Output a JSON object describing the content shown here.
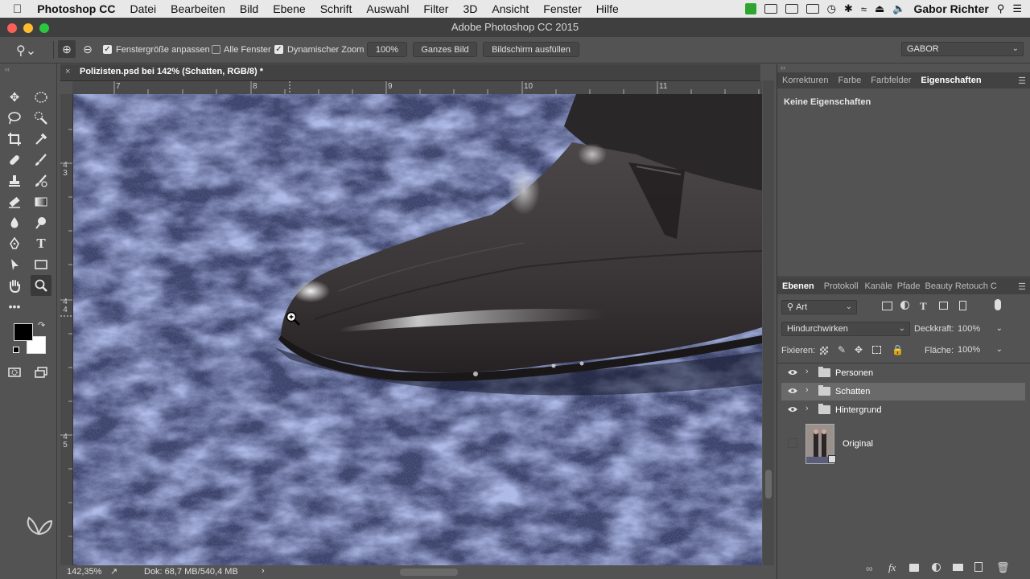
{
  "menubar": {
    "app_name": "Photoshop CC",
    "items": [
      "Datei",
      "Bearbeiten",
      "Bild",
      "Ebene",
      "Schrift",
      "Auswahl",
      "Filter",
      "3D",
      "Ansicht",
      "Fenster",
      "Hilfe"
    ],
    "user": "Gabor Richter"
  },
  "window": {
    "title": "Adobe Photoshop CC 2015"
  },
  "options_bar": {
    "resize_windows_label": "Fenstergröße anpassen",
    "all_windows_label": "Alle Fenster",
    "scrubby_zoom_label": "Dynamischer Zoom",
    "zoom_100_button": "100%",
    "fit_screen_button": "Ganzes Bild",
    "fill_screen_button": "Bildschirm ausfüllen",
    "workspace": "GABOR"
  },
  "document": {
    "tab_title": "Polizisten.psd bei 142% (Schatten, RGB/8) *",
    "h_ruler_labels": [
      "7",
      "8",
      "9",
      "10",
      "11"
    ],
    "v_ruler_labels": [
      "4\n3",
      "4\n4",
      "4\n5"
    ],
    "zoom": "142,35%",
    "doc_size": "Dok: 68,7 MB/540,4 MB"
  },
  "properties_panel": {
    "tabs": [
      "Korrekturen",
      "Farbe",
      "Farbfelder",
      "Eigenschaften"
    ],
    "active_tab": "Eigenschaften",
    "empty_text": "Keine Eigenschaften"
  },
  "layers_panel": {
    "tabs": [
      "Ebenen",
      "Protokoll",
      "Kanäle",
      "Pfade",
      "Beauty Retouch C"
    ],
    "active_tab": "Ebenen",
    "filter_kind": "Art",
    "blend_mode": "Hindurchwirken",
    "opacity_label": "Deckkraft:",
    "opacity_value": "100%",
    "lock_label": "Fixieren:",
    "fill_label": "Fläche:",
    "fill_value": "100%",
    "layers": [
      {
        "name": "Personen",
        "type": "group",
        "visible": true,
        "selected": false
      },
      {
        "name": "Schatten",
        "type": "group",
        "visible": true,
        "selected": true
      },
      {
        "name": "Hintergrund",
        "type": "group",
        "visible": true,
        "selected": false
      },
      {
        "name": "Original",
        "type": "smart-object",
        "visible": false,
        "selected": false
      }
    ]
  },
  "colors": {
    "menubar_bg": "#e8e8e8",
    "panel_bg": "#535353",
    "tab_bg": "#424242",
    "selected_layer": "#6a6a6a",
    "canvas_blue": "#5a6aa0"
  }
}
